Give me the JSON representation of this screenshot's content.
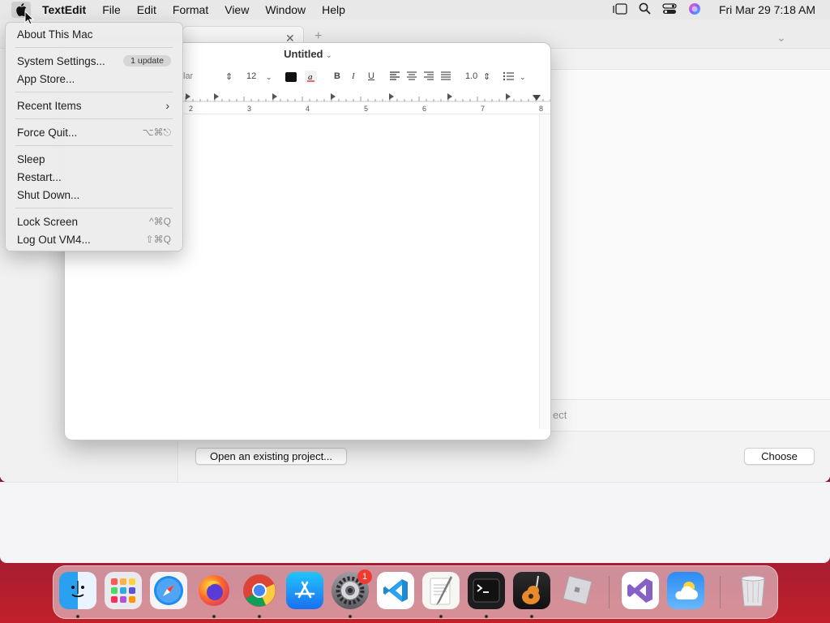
{
  "menubar": {
    "app_name": "TextEdit",
    "menus": [
      "File",
      "Edit",
      "Format",
      "View",
      "Window",
      "Help"
    ],
    "clock": "Fri Mar 29  7:18 AM"
  },
  "apple_menu": {
    "about": "About This Mac",
    "system_settings": "System Settings...",
    "system_settings_badge": "1 update",
    "app_store": "App Store...",
    "recent_items": "Recent Items",
    "force_quit": "Force Quit...",
    "force_quit_shortcut": "⌥⌘⎋",
    "sleep": "Sleep",
    "restart": "Restart...",
    "shut_down": "Shut Down...",
    "lock_screen": "Lock Screen",
    "lock_screen_shortcut": "^⌘Q",
    "log_out": "Log Out VM4...",
    "log_out_shortcut": "⇧⌘Q"
  },
  "textedit": {
    "title": "Untitled",
    "font_fragment": "lar",
    "font_size": "12",
    "line_spacing": "1.0",
    "ruler_numbers": [
      "2",
      "3",
      "4",
      "5",
      "6",
      "7",
      "8"
    ]
  },
  "bg_window": {
    "open_button": "Open an existing project...",
    "choose_button": "Choose",
    "field_fragment": "ect"
  },
  "dock": {
    "apps": [
      "Finder",
      "Launchpad",
      "Safari",
      "Firefox",
      "Chrome",
      "App Store",
      "System Settings",
      "Visual Studio Code",
      "TextEdit",
      "Terminal",
      "GarageBand",
      "Roblox",
      "Visual Studio",
      "Weather",
      "Trash"
    ],
    "settings_badge": "1"
  }
}
